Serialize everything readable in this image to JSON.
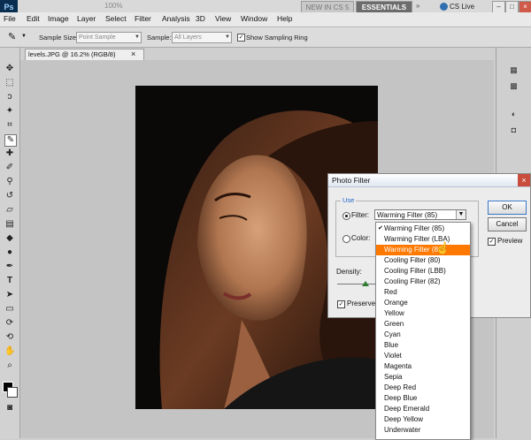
{
  "appbar": {
    "logo": "Ps",
    "zoom": "100%",
    "workspace_new": "NEW IN CS 5",
    "workspace_essentials": "ESSENTIALS",
    "cs_live": "CS Live",
    "arrow": "»"
  },
  "menubar": [
    "File",
    "Edit",
    "Image",
    "Layer",
    "Select",
    "Filter",
    "Analysis",
    "3D",
    "View",
    "Window",
    "Help"
  ],
  "options": {
    "sample_size_label": "Sample Size:",
    "sample_size_value": "Point Sample",
    "sample_label": "Sample:",
    "sample_value": "All Layers",
    "show_ring_label": "Show Sampling Ring",
    "show_ring_checked": "✓"
  },
  "document": {
    "tab_title": "levels.JPG @ 16.2% (RGB/8)",
    "tab_close": "×"
  },
  "dialog": {
    "title": "Photo Filter",
    "close": "×",
    "use_label": "Use",
    "filter_label": "Filter:",
    "filter_value": "Warming Filter (85)",
    "color_label": "Color:",
    "ok": "OK",
    "cancel": "Cancel",
    "preview_label": "Preview",
    "preview_checked": "✓",
    "density_label": "Density:",
    "preserve_label": "Preserve",
    "preserve_checked": "✓"
  },
  "dropdown": {
    "items": [
      {
        "label": "Warming Filter (85)",
        "checked": true
      },
      {
        "label": "Warming Filter (LBA)"
      },
      {
        "label": "Warming Filter (81)",
        "highlighted": true
      },
      {
        "label": "Cooling Filter (80)"
      },
      {
        "label": "Cooling Filter (LBB)"
      },
      {
        "label": "Cooling Filter (82)"
      },
      {
        "label": "Red"
      },
      {
        "label": "Orange"
      },
      {
        "label": "Yellow"
      },
      {
        "label": "Green"
      },
      {
        "label": "Cyan"
      },
      {
        "label": "Blue"
      },
      {
        "label": "Violet"
      },
      {
        "label": "Magenta"
      },
      {
        "label": "Sepia"
      },
      {
        "label": "Deep Red"
      },
      {
        "label": "Deep Blue"
      },
      {
        "label": "Deep Emerald"
      },
      {
        "label": "Deep Yellow"
      },
      {
        "label": "Underwater"
      }
    ],
    "highlight_color": "#ff7800"
  },
  "colors": {
    "accent": "#ff7800",
    "canvas_bg": "#c4c4c4"
  }
}
